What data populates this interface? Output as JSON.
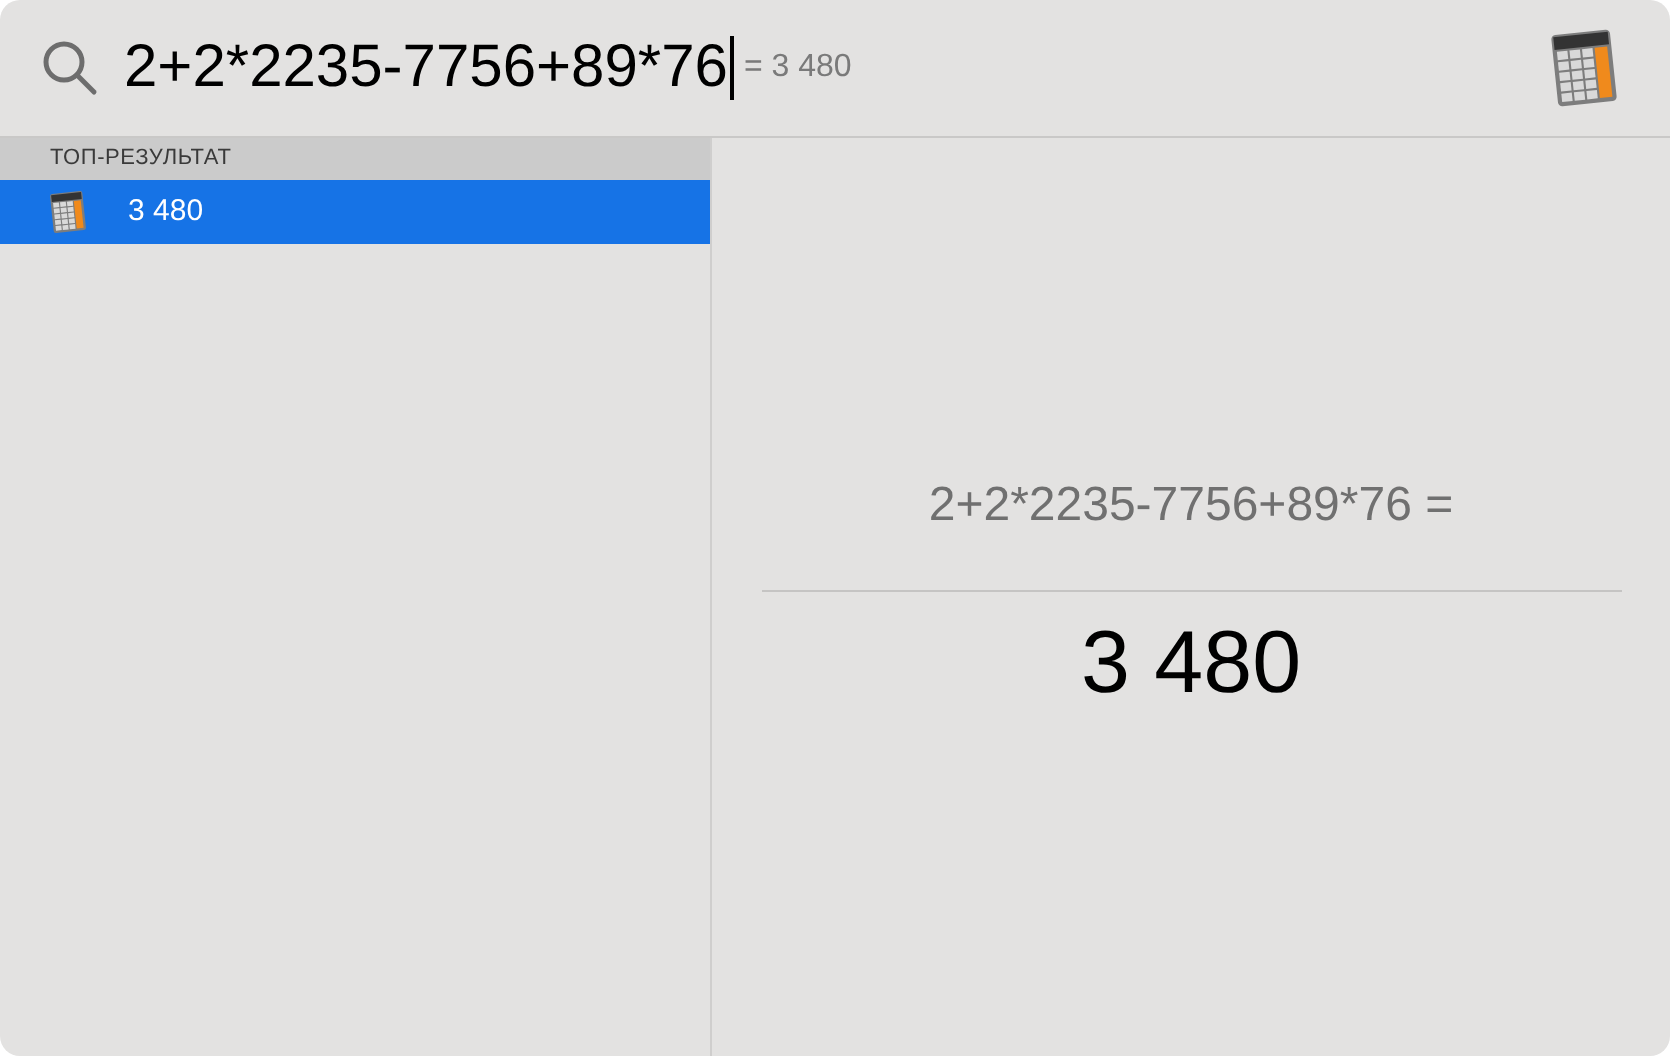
{
  "search": {
    "value": "2+2*2235-7756+89*76",
    "inline_result": "= 3 480"
  },
  "sections": [
    {
      "title": "ТОП-РЕЗУЛЬТАТ",
      "results": [
        {
          "label": "3 480",
          "selected": true
        }
      ]
    }
  ],
  "preview": {
    "expression": "2+2*2235-7756+89*76 =",
    "result": "3 480"
  }
}
